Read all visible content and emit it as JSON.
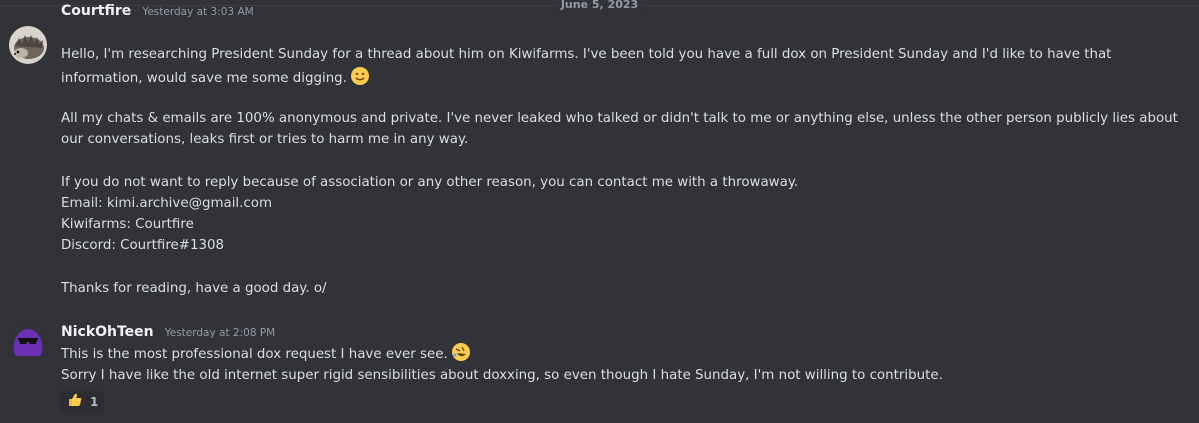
{
  "divider": {
    "date": "June 5, 2023"
  },
  "messages": [
    {
      "username": "Courtfire",
      "timestamp": "Yesterday at 3:03 AM",
      "avatar_icon": "hedgehog-avatar",
      "lines": [
        "Hello, I'm researching President Sunday for a thread about him on Kiwifarms. I've been told you have a full dox on President Sunday and I'd like to have that",
        "information, would save me some digging.",
        "All my chats & emails are 100% anonymous and private. I've never leaked who talked or didn't talk to me or anything else, unless the other person publicly lies about",
        "our conversations, leaks first or tries to harm me in any way.",
        "If you do not want to reply because of association or any other reason, you can contact me with a throwaway.",
        "Email: kimi.archive@gmail.com",
        "Kiwifarms: Courtfire",
        "Discord: Courtfire#1308",
        "Thanks for reading, have a good day. o/"
      ],
      "emoji": "slightly-smiling-face"
    },
    {
      "username": "NickOhTeen",
      "timestamp": "Yesterday at 2:08 PM",
      "avatar_icon": "purple-blob-sunglasses-avatar",
      "lines": [
        "This is the most professional dox request I have ever see.",
        "Sorry I have like the old internet super rigid sensibilities about doxxing, so even though I hate Sunday, I'm not willing to contribute."
      ],
      "emoji": "rolling-on-floor-laughing-face",
      "reaction": {
        "icon": "thumbs-up",
        "count": "1"
      }
    }
  ],
  "colors": {
    "background": "#313338",
    "username": "#f2f3f5",
    "text": "#dbdee1",
    "muted": "#949ba4",
    "reaction_bg": "#2b2d31"
  }
}
